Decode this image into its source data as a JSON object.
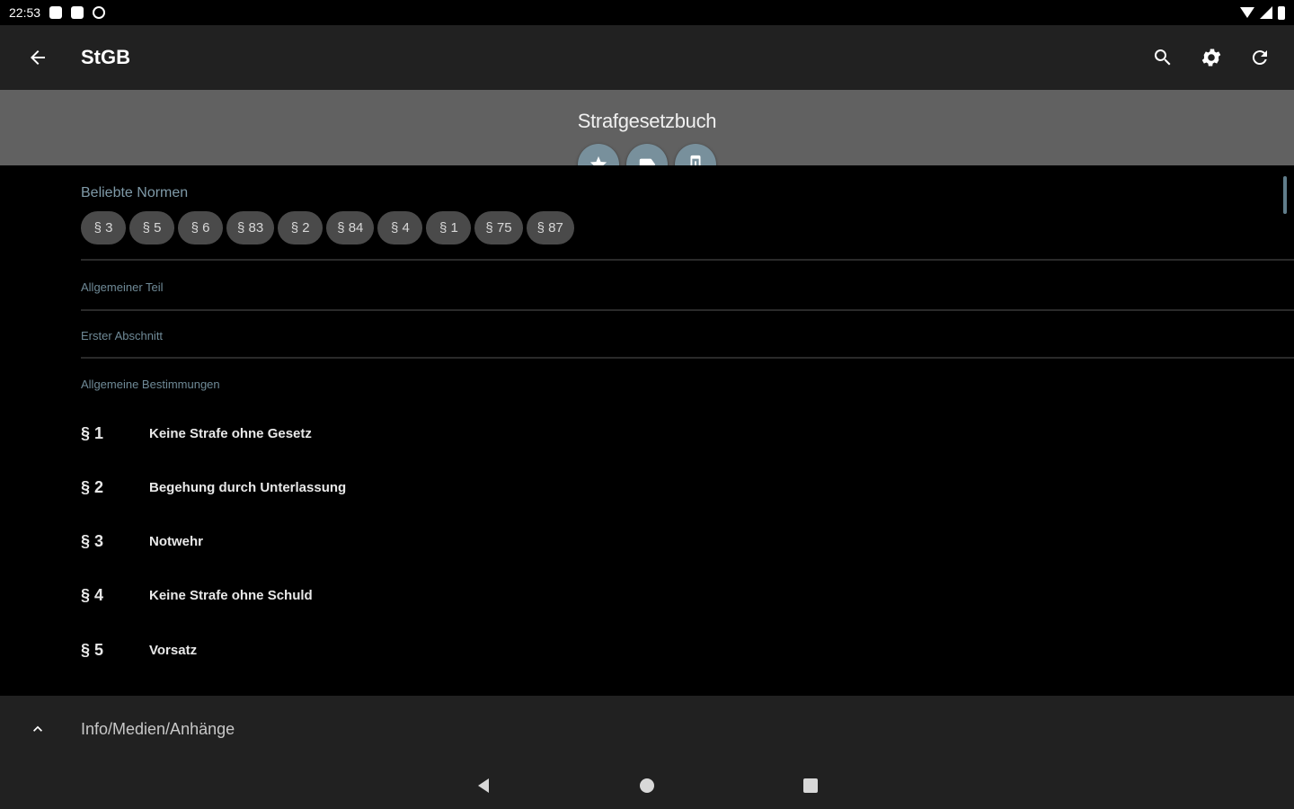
{
  "status_bar": {
    "time": "22:53"
  },
  "app_bar": {
    "title": "StGB"
  },
  "header": {
    "title": "Strafgesetzbuch"
  },
  "popular": {
    "label": "Beliebte Normen",
    "chips": [
      "§ 3",
      "§ 5",
      "§ 6",
      "§ 83",
      "§ 2",
      "§ 84",
      "§ 4",
      "§ 1",
      "§ 75",
      "§ 87"
    ]
  },
  "sections": {
    "part": "Allgemeiner Teil",
    "chapter": "Erster Abschnitt",
    "title": "Allgemeine Bestimmungen"
  },
  "norms": [
    {
      "num": "§ 1",
      "title": "Keine Strafe ohne Gesetz"
    },
    {
      "num": "§ 2",
      "title": "Begehung durch Unterlassung"
    },
    {
      "num": "§ 3",
      "title": "Notwehr"
    },
    {
      "num": "§ 4",
      "title": "Keine Strafe ohne Schuld"
    },
    {
      "num": "§ 5",
      "title": "Vorsatz"
    }
  ],
  "bottom_sheet": {
    "label": "Info/Medien/Anhänge"
  },
  "colors": {
    "accent": "#78909c",
    "app_bar": "#212121",
    "sub_header": "#616161",
    "chip": "#4a4a4a"
  },
  "icons": {
    "back": "arrow-left-icon",
    "search": "search-icon",
    "settings": "gear-icon",
    "refresh": "refresh-icon",
    "favorite": "star-icon",
    "label": "tag-icon",
    "device": "phone-icon",
    "expand": "chevron-up-icon"
  }
}
